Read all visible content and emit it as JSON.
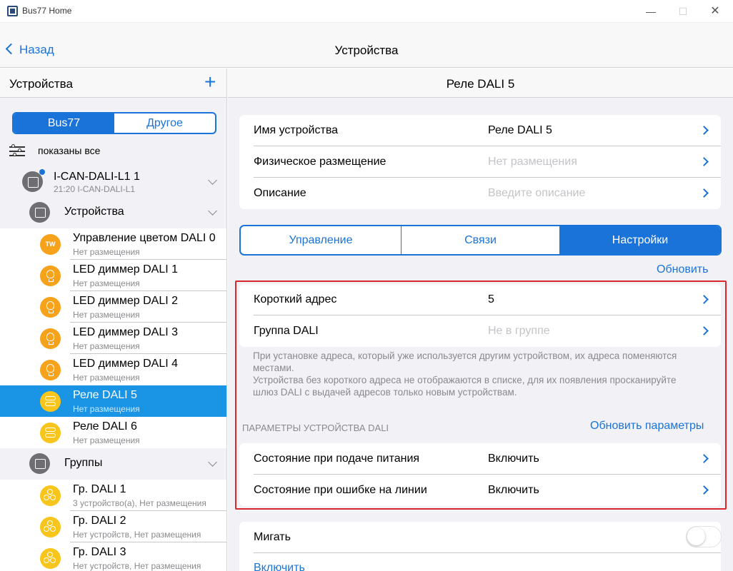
{
  "window": {
    "title": "Bus77 Home",
    "minimize": "—",
    "maximize": "☐",
    "close": "✕"
  },
  "nav": {
    "back_label": "Назад",
    "title": "Устройства"
  },
  "sidebar": {
    "header": "Устройства",
    "add_label": "+",
    "segments": [
      "Bus77",
      "Другое"
    ],
    "filter_label": "показаны все",
    "gateway": {
      "name": "I-CAN-DALI-L1 1",
      "sub": "21:20 I-CAN-DALI-L1"
    },
    "devices_folder": "Устройства",
    "devices": [
      {
        "name": "Управление цветом DALI 0",
        "sub": "Нет размещения",
        "icon": "TW"
      },
      {
        "name": "LED диммер DALI 1",
        "sub": "Нет размещения",
        "icon": "bulb"
      },
      {
        "name": "LED диммер DALI 2",
        "sub": "Нет размещения",
        "icon": "bulb"
      },
      {
        "name": "LED диммер DALI 3",
        "sub": "Нет размещения",
        "icon": "bulb"
      },
      {
        "name": "LED диммер DALI 4",
        "sub": "Нет размещения",
        "icon": "bulb"
      },
      {
        "name": "Реле DALI 5",
        "sub": "Нет размещения",
        "icon": "switch"
      },
      {
        "name": "Реле DALI 6",
        "sub": "Нет размещения",
        "icon": "switch"
      }
    ],
    "groups_folder": "Группы",
    "groups": [
      {
        "name": "Гр. DALI 1",
        "sub": "3 устройство(а), Нет размещения"
      },
      {
        "name": "Гр. DALI 2",
        "sub": "Нет устройств, Нет размещения"
      },
      {
        "name": "Гр. DALI 3",
        "sub": "Нет устройств, Нет размещения"
      }
    ]
  },
  "detail": {
    "title": "Реле DALI 5",
    "info": {
      "name_label": "Имя устройства",
      "name_value": "Реле DALI 5",
      "placement_label": "Физическое размещение",
      "placement_value": "Нет размещения",
      "description_label": "Описание",
      "description_value": "Введите описание"
    },
    "tabs": [
      "Управление",
      "Связи",
      "Настройки"
    ],
    "refresh_label": "Обновить",
    "address": {
      "short_label": "Короткий адрес",
      "short_value": "5",
      "group_label": "Группа DALI",
      "group_value": "Не в группе"
    },
    "note_1": "При установке адреса, который уже используется другим устройством, их адреса поменяются местами.",
    "note_2": "Устройства без короткого адреса не отображаются в списке, для их появления просканируйте шлюз DALI с выдачей адресов только новым устройствам.",
    "params_header": "ПАРАМЕТРЫ УСТРОЙСТВА DALI",
    "params_refresh_label": "Обновить параметры",
    "params": {
      "power_on_label": "Состояние при подаче питания",
      "power_on_value": "Включить",
      "line_error_label": "Состояние при ошибке на линии",
      "line_error_value": "Включить"
    },
    "blink_label": "Мигать",
    "blink_on": false,
    "enable_label": "Включить"
  }
}
